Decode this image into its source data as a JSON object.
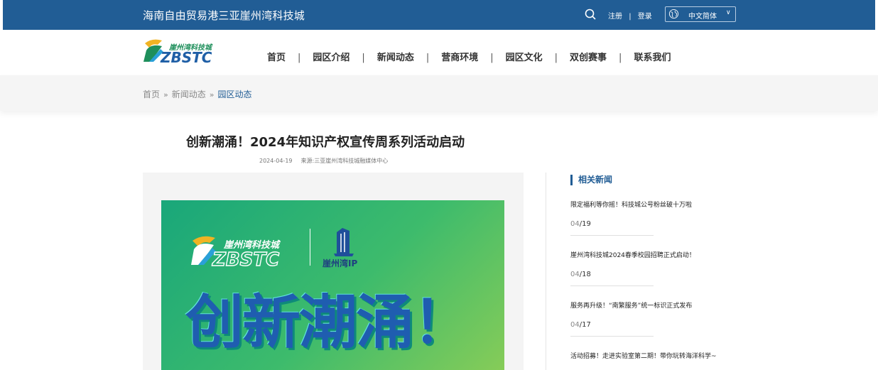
{
  "topbar": {
    "site_title": "海南自由贸易港三亚崖州湾科技城",
    "register": "注册",
    "separator": "|",
    "login": "登录",
    "language": "中文简体",
    "chevron": "∨",
    "bg_color": "#215d95"
  },
  "logo": {
    "cn": "崖州湾科技城",
    "en": "ZBSTC"
  },
  "nav": {
    "items": [
      "首页",
      "园区介绍",
      "新闻动态",
      "营商环境",
      "园区文化",
      "双创赛事",
      "联系我们"
    ],
    "divider": "|"
  },
  "breadcrumb": {
    "items": [
      "首页",
      "新闻动态"
    ],
    "current": "园区动态",
    "arrow": "»"
  },
  "article": {
    "title": "创新潮涌！2024年知识产权宣传周系列活动启动",
    "date": "2024-04-19",
    "source": "来源:三亚崖州湾科技城融媒体中心"
  },
  "banner": {
    "logo_cn": "崖州湾科技城",
    "logo_en": "ZBSTC",
    "ip_label": "崖州湾IP",
    "headline": "创新潮涌！"
  },
  "related": {
    "title": "相关新闻",
    "items": [
      {
        "headline": "限定福利等你摇！科技城公号粉丝破十万啦",
        "month": "04",
        "day": "/19"
      },
      {
        "headline": "崖州湾科技城2024春季校园招聘正式启动！",
        "month": "04",
        "day": "/18"
      },
      {
        "headline": "服务再升级！“南繁服务”统一标识正式发布",
        "month": "04",
        "day": "/17"
      },
      {
        "headline": "活动招募！走进实验室第二期！带你玩转海洋科学~"
      }
    ]
  },
  "icons": {
    "search": "search-icon",
    "globe": "globe-icon"
  }
}
